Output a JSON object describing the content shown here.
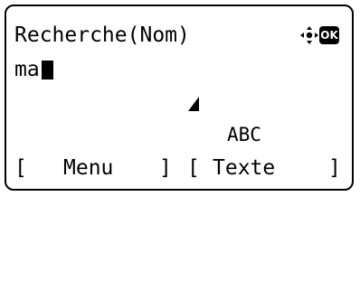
{
  "screen": {
    "title": "Recherche(Nom)",
    "input_value": "ma",
    "input_mode": "ABC",
    "status_icons": [
      "nav-cross-icon",
      "ok-icon"
    ],
    "ok_label": "OK"
  },
  "softkeys": {
    "left_open": "[",
    "left_label": "Menu",
    "left_close": "]",
    "right_open": "[",
    "right_label": "Texte",
    "right_close": "]"
  }
}
